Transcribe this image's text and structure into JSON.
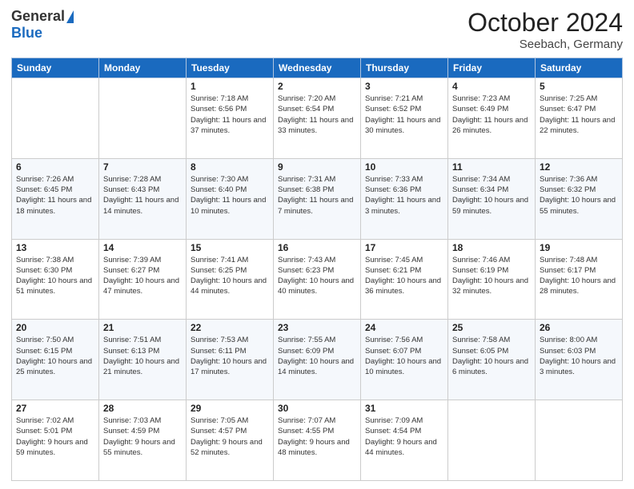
{
  "header": {
    "logo": {
      "general": "General",
      "blue": "Blue"
    },
    "month": "October 2024",
    "location": "Seebach, Germany"
  },
  "weekdays": [
    "Sunday",
    "Monday",
    "Tuesday",
    "Wednesday",
    "Thursday",
    "Friday",
    "Saturday"
  ],
  "weeks": [
    [
      {
        "day": "",
        "info": ""
      },
      {
        "day": "",
        "info": ""
      },
      {
        "day": "1",
        "info": "Sunrise: 7:18 AM\nSunset: 6:56 PM\nDaylight: 11 hours and 37 minutes."
      },
      {
        "day": "2",
        "info": "Sunrise: 7:20 AM\nSunset: 6:54 PM\nDaylight: 11 hours and 33 minutes."
      },
      {
        "day": "3",
        "info": "Sunrise: 7:21 AM\nSunset: 6:52 PM\nDaylight: 11 hours and 30 minutes."
      },
      {
        "day": "4",
        "info": "Sunrise: 7:23 AM\nSunset: 6:49 PM\nDaylight: 11 hours and 26 minutes."
      },
      {
        "day": "5",
        "info": "Sunrise: 7:25 AM\nSunset: 6:47 PM\nDaylight: 11 hours and 22 minutes."
      }
    ],
    [
      {
        "day": "6",
        "info": "Sunrise: 7:26 AM\nSunset: 6:45 PM\nDaylight: 11 hours and 18 minutes."
      },
      {
        "day": "7",
        "info": "Sunrise: 7:28 AM\nSunset: 6:43 PM\nDaylight: 11 hours and 14 minutes."
      },
      {
        "day": "8",
        "info": "Sunrise: 7:30 AM\nSunset: 6:40 PM\nDaylight: 11 hours and 10 minutes."
      },
      {
        "day": "9",
        "info": "Sunrise: 7:31 AM\nSunset: 6:38 PM\nDaylight: 11 hours and 7 minutes."
      },
      {
        "day": "10",
        "info": "Sunrise: 7:33 AM\nSunset: 6:36 PM\nDaylight: 11 hours and 3 minutes."
      },
      {
        "day": "11",
        "info": "Sunrise: 7:34 AM\nSunset: 6:34 PM\nDaylight: 10 hours and 59 minutes."
      },
      {
        "day": "12",
        "info": "Sunrise: 7:36 AM\nSunset: 6:32 PM\nDaylight: 10 hours and 55 minutes."
      }
    ],
    [
      {
        "day": "13",
        "info": "Sunrise: 7:38 AM\nSunset: 6:30 PM\nDaylight: 10 hours and 51 minutes."
      },
      {
        "day": "14",
        "info": "Sunrise: 7:39 AM\nSunset: 6:27 PM\nDaylight: 10 hours and 47 minutes."
      },
      {
        "day": "15",
        "info": "Sunrise: 7:41 AM\nSunset: 6:25 PM\nDaylight: 10 hours and 44 minutes."
      },
      {
        "day": "16",
        "info": "Sunrise: 7:43 AM\nSunset: 6:23 PM\nDaylight: 10 hours and 40 minutes."
      },
      {
        "day": "17",
        "info": "Sunrise: 7:45 AM\nSunset: 6:21 PM\nDaylight: 10 hours and 36 minutes."
      },
      {
        "day": "18",
        "info": "Sunrise: 7:46 AM\nSunset: 6:19 PM\nDaylight: 10 hours and 32 minutes."
      },
      {
        "day": "19",
        "info": "Sunrise: 7:48 AM\nSunset: 6:17 PM\nDaylight: 10 hours and 28 minutes."
      }
    ],
    [
      {
        "day": "20",
        "info": "Sunrise: 7:50 AM\nSunset: 6:15 PM\nDaylight: 10 hours and 25 minutes."
      },
      {
        "day": "21",
        "info": "Sunrise: 7:51 AM\nSunset: 6:13 PM\nDaylight: 10 hours and 21 minutes."
      },
      {
        "day": "22",
        "info": "Sunrise: 7:53 AM\nSunset: 6:11 PM\nDaylight: 10 hours and 17 minutes."
      },
      {
        "day": "23",
        "info": "Sunrise: 7:55 AM\nSunset: 6:09 PM\nDaylight: 10 hours and 14 minutes."
      },
      {
        "day": "24",
        "info": "Sunrise: 7:56 AM\nSunset: 6:07 PM\nDaylight: 10 hours and 10 minutes."
      },
      {
        "day": "25",
        "info": "Sunrise: 7:58 AM\nSunset: 6:05 PM\nDaylight: 10 hours and 6 minutes."
      },
      {
        "day": "26",
        "info": "Sunrise: 8:00 AM\nSunset: 6:03 PM\nDaylight: 10 hours and 3 minutes."
      }
    ],
    [
      {
        "day": "27",
        "info": "Sunrise: 7:02 AM\nSunset: 5:01 PM\nDaylight: 9 hours and 59 minutes."
      },
      {
        "day": "28",
        "info": "Sunrise: 7:03 AM\nSunset: 4:59 PM\nDaylight: 9 hours and 55 minutes."
      },
      {
        "day": "29",
        "info": "Sunrise: 7:05 AM\nSunset: 4:57 PM\nDaylight: 9 hours and 52 minutes."
      },
      {
        "day": "30",
        "info": "Sunrise: 7:07 AM\nSunset: 4:55 PM\nDaylight: 9 hours and 48 minutes."
      },
      {
        "day": "31",
        "info": "Sunrise: 7:09 AM\nSunset: 4:54 PM\nDaylight: 9 hours and 44 minutes."
      },
      {
        "day": "",
        "info": ""
      },
      {
        "day": "",
        "info": ""
      }
    ]
  ]
}
